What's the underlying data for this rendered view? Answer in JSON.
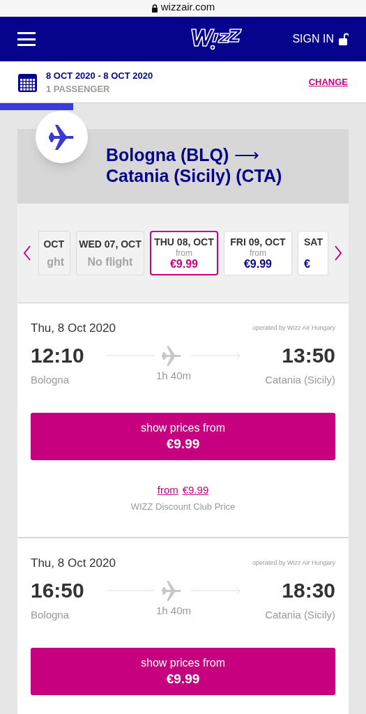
{
  "browser": {
    "url": "wizzair.com"
  },
  "header": {
    "sign_in": "SIGN IN"
  },
  "trip": {
    "dates": "8 OCT 2020 - 8 OCT 2020",
    "passengers": "1 PASSENGER",
    "change": "CHANGE"
  },
  "progress": {
    "level": 0.2
  },
  "route": {
    "origin": "Bologna (BLQ)",
    "arrow": "⟶",
    "destination": "Catania (Sicily) (CTA)"
  },
  "dates": [
    {
      "kind": "no-flight",
      "day": "OCT",
      "note": "ght",
      "selected": false
    },
    {
      "kind": "no-flight",
      "day": "WED 07, OCT",
      "note": "No flight",
      "selected": false
    },
    {
      "kind": "price",
      "day": "THU 08, OCT",
      "from": "from",
      "price": "€9.99",
      "selected": true
    },
    {
      "kind": "price",
      "day": "FRI 09, OCT",
      "from": "from",
      "price": "€9.99",
      "selected": false
    },
    {
      "kind": "price",
      "day": "SAT",
      "price": "€",
      "selected": false
    }
  ],
  "flights": [
    {
      "date": "Thu, 8 Oct 2020",
      "operator": "operated by Wizz Air Hungary",
      "depart": "12:10",
      "arrive": "13:50",
      "origin": "Bologna",
      "destination": "Catania (Sicily)",
      "duration": "1h 40m",
      "button": {
        "label": "show prices from",
        "price": "€9.99"
      },
      "club": {
        "from": "from",
        "price": "€9.99",
        "label": "WIZZ Discount Club Price"
      }
    },
    {
      "date": "Thu, 8 Oct 2020",
      "operator": "operated by Wizz Air Hungary",
      "depart": "16:50",
      "arrive": "18:30",
      "origin": "Bologna",
      "destination": "Catania (Sicily)",
      "duration": "1h 40m",
      "button": {
        "label": "show prices from",
        "price": "€9.99"
      }
    }
  ]
}
